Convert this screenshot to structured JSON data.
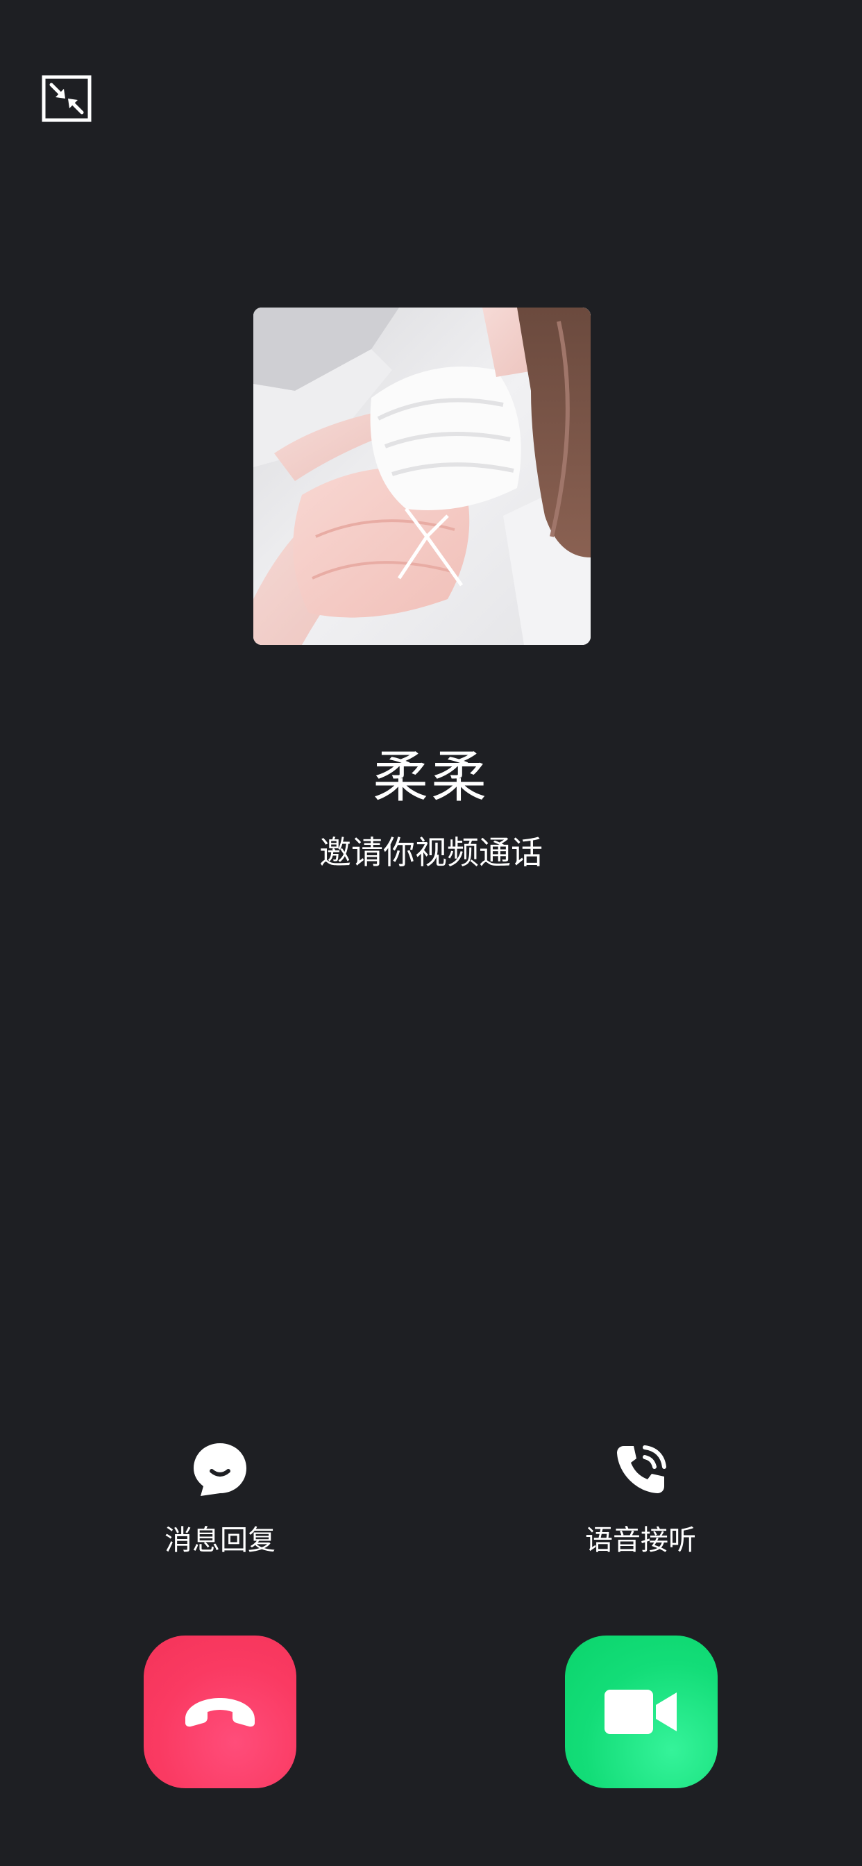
{
  "caller": {
    "name": "柔柔",
    "subtitle": "邀请你视频通话"
  },
  "actions": {
    "message_reply": {
      "label": "消息回复",
      "icon": "chat-bubble-icon"
    },
    "voice_answer": {
      "label": "语音接听",
      "icon": "phone-ringing-icon"
    }
  },
  "buttons": {
    "decline": {
      "icon": "hang-up-icon",
      "color": "#f43459"
    },
    "accept_video": {
      "icon": "video-camera-icon",
      "color": "#0bd46c"
    }
  },
  "top_bar": {
    "minimize_icon": "minimize-icon"
  },
  "theme": {
    "background": "#1e1f23"
  }
}
